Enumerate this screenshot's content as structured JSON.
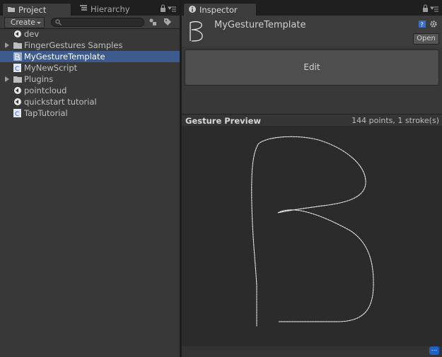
{
  "project_panel": {
    "tabs": [
      {
        "label": "Project",
        "icon": "folder-icon",
        "active": true
      },
      {
        "label": "Hierarchy",
        "icon": "list-icon",
        "active": false
      }
    ],
    "create_label": "Create",
    "search": {
      "placeholder": "",
      "value": ""
    },
    "items": [
      {
        "label": "dev",
        "icon": "unity-scene-icon",
        "expandable": false,
        "selected": false
      },
      {
        "label": "FingerGestures Samples",
        "icon": "folder-icon",
        "expandable": true,
        "selected": false
      },
      {
        "label": "MyGestureTemplate",
        "icon": "gesture-template-icon",
        "expandable": false,
        "selected": true
      },
      {
        "label": "MyNewScript",
        "icon": "csharp-script-icon",
        "expandable": false,
        "selected": false
      },
      {
        "label": "Plugins",
        "icon": "folder-icon",
        "expandable": true,
        "selected": false
      },
      {
        "label": "pointcloud",
        "icon": "unity-scene-icon",
        "expandable": false,
        "selected": false
      },
      {
        "label": "quickstart tutorial",
        "icon": "unity-scene-icon",
        "expandable": false,
        "selected": false
      },
      {
        "label": "TapTutorial",
        "icon": "csharp-script-icon",
        "expandable": false,
        "selected": false
      }
    ]
  },
  "inspector": {
    "tab_label": "Inspector",
    "title": "MyGestureTemplate",
    "thumbnail_glyph": "B",
    "open_label": "Open",
    "edit_label": "Edit",
    "preview": {
      "title": "Gesture Preview",
      "stats": "144 points, 1 stroke(s)"
    },
    "more_label": "..."
  },
  "colors": {
    "selection": "#3c5b8c",
    "panel_bg": "#383838",
    "stroke": "#e6e6e6"
  }
}
